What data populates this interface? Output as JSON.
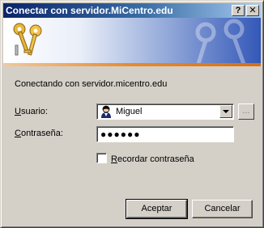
{
  "window": {
    "title": "Conectar con servidor.MiCentro.edu",
    "help_label": "?",
    "close_label": "✕"
  },
  "icons": {
    "banner": "keys-icon",
    "user": "user-icon",
    "dropdown": "chevron-down-icon",
    "close": "close-icon",
    "help": "help-icon"
  },
  "body": {
    "connecting_text": "Conectando con servidor.micentro.edu"
  },
  "form": {
    "user_label_first": "U",
    "user_label_rest": "suario:",
    "user_value": "Miguel",
    "browse_label": "...",
    "password_label_first": "C",
    "password_label_rest": "ontraseña:",
    "password_value": "●●●●●●",
    "remember_first": "R",
    "remember_rest": "ecordar contraseña",
    "remember_checked": false
  },
  "buttons": {
    "ok": "Aceptar",
    "cancel": "Cancelar"
  }
}
